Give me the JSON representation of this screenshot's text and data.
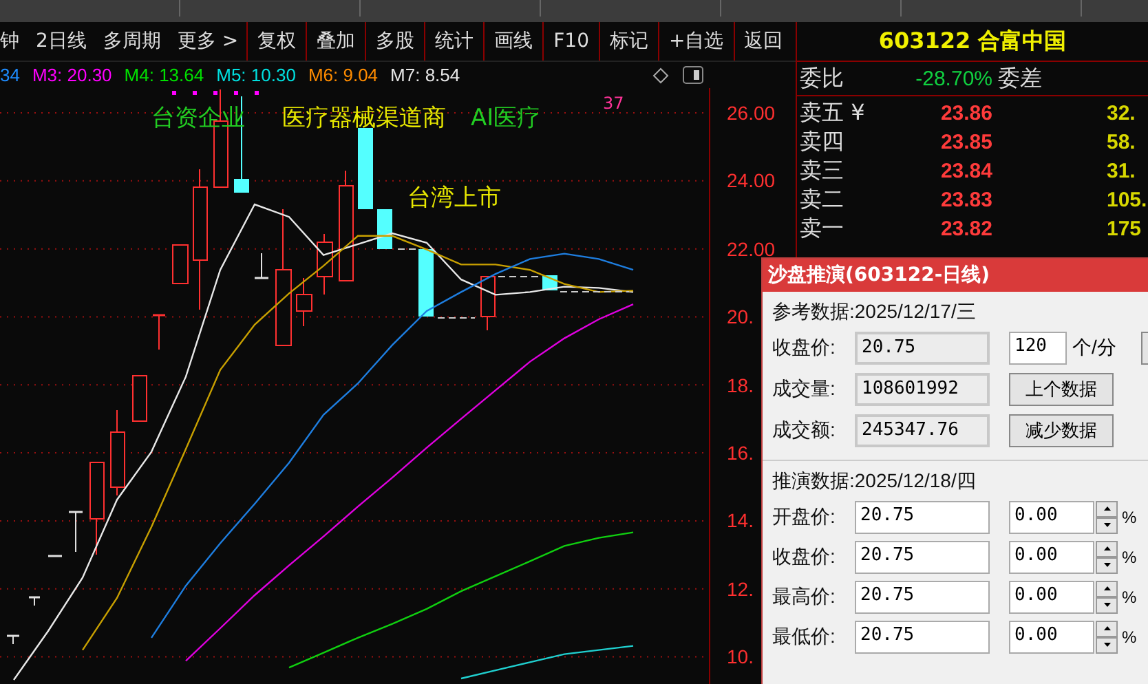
{
  "toolbar": {
    "items": [
      {
        "label": "钟",
        "boxed": false
      },
      {
        "label": "2日线",
        "boxed": false
      },
      {
        "label": "多周期",
        "boxed": false
      },
      {
        "label": "更多 >",
        "boxed": false
      },
      {
        "label": "复权",
        "boxed": true
      },
      {
        "label": "叠加",
        "boxed": true
      },
      {
        "label": "多股",
        "boxed": true
      },
      {
        "label": "统计",
        "boxed": true
      },
      {
        "label": "画线",
        "boxed": true
      },
      {
        "label": "F10",
        "boxed": true
      },
      {
        "label": "标记",
        "boxed": true
      },
      {
        "label": "+自选",
        "boxed": true
      },
      {
        "label": "返回",
        "boxed": true
      }
    ]
  },
  "indicators": [
    {
      "label": "34",
      "color": "#1e8cff"
    },
    {
      "label": "M3: 20.30",
      "color": "#ff00ff"
    },
    {
      "label": "M4: 13.64",
      "color": "#00e000"
    },
    {
      "label": "M5: 10.30",
      "color": "#00e0e0"
    },
    {
      "label": "M6: 9.04",
      "color": "#ff8c00"
    },
    {
      "label": "M7: 8.54",
      "color": "#e8e8e8"
    }
  ],
  "chart": {
    "annotations": [
      {
        "text": "台资企业",
        "color": "#22cc22"
      },
      {
        "text": "医疗器械渠道商",
        "color": "#e8e800"
      },
      {
        "text": "AI医疗",
        "color": "#22cc22"
      },
      {
        "text": "37",
        "color": "#ff3399"
      },
      {
        "text": "台湾上市",
        "color": "#e8e800"
      }
    ],
    "chart_data": {
      "type": "line",
      "grid": true,
      "ylim": [
        9.2,
        26.73
      ],
      "yticks": [
        {
          "value": 26,
          "label": "26.00"
        },
        {
          "value": 24,
          "label": "24.00"
        },
        {
          "value": 22,
          "label": "22.00"
        },
        {
          "value": 20,
          "label": "20."
        },
        {
          "value": 18,
          "label": "18."
        },
        {
          "value": 16,
          "label": "16."
        },
        {
          "value": 14,
          "label": "14."
        },
        {
          "value": 12,
          "label": "12."
        },
        {
          "value": 10,
          "label": "10."
        }
      ],
      "series": [
        {
          "color": "#e8e8e8",
          "values": [
            9.32,
            10.76,
            12.33,
            14.62,
            16.03,
            18.24,
            21.38,
            23.31,
            22.94,
            21.82,
            22.14,
            22.46,
            22.18,
            21.1,
            20.65,
            20.73,
            20.89,
            20.85,
            20.73
          ]
        },
        {
          "color": "#c8a000",
          "values": [
            null,
            null,
            10.2,
            11.73,
            13.82,
            16.11,
            18.44,
            19.77,
            20.69,
            21.5,
            22.38,
            22.38,
            21.98,
            21.54,
            21.54,
            21.38,
            20.97,
            20.73,
            20.77
          ]
        },
        {
          "color": "#1e7ee0",
          "values": [
            null,
            null,
            null,
            null,
            10.56,
            12.09,
            13.34,
            14.5,
            15.71,
            17.12,
            18.04,
            19.17,
            20.17,
            20.73,
            21.26,
            21.7,
            21.86,
            21.7,
            21.38
          ]
        },
        {
          "color": "#e000e0",
          "values": [
            null,
            null,
            null,
            null,
            null,
            9.88,
            10.84,
            11.81,
            12.69,
            13.54,
            14.42,
            15.27,
            16.15,
            17.0,
            17.84,
            18.68,
            19.37,
            19.93,
            20.37
          ]
        },
        {
          "color": "#10d010",
          "values": [
            null,
            null,
            null,
            null,
            null,
            null,
            null,
            null,
            9.68,
            10.12,
            10.56,
            10.97,
            11.41,
            11.93,
            12.37,
            12.81,
            13.26,
            13.5,
            13.66
          ]
        },
        {
          "color": "#20d0d0",
          "values": [
            null,
            null,
            null,
            null,
            null,
            null,
            null,
            null,
            null,
            null,
            null,
            null,
            null,
            9.36,
            9.6,
            9.84,
            10.08,
            10.2,
            10.32
          ]
        }
      ]
    }
  },
  "quote": {
    "code": "603122",
    "name": "合富中国",
    "ratio_label": "委比",
    "ratio": "-28.70%",
    "diff_label": "委差",
    "asks": [
      {
        "label": "卖五 ¥",
        "price": "23.86",
        "volume": "32."
      },
      {
        "label": "卖四",
        "price": "23.85",
        "volume": "58."
      },
      {
        "label": "卖三",
        "price": "23.84",
        "volume": "31."
      },
      {
        "label": "卖二",
        "price": "23.83",
        "volume": "105."
      },
      {
        "label": "卖一",
        "price": "23.82",
        "volume": "175"
      }
    ]
  },
  "dialog": {
    "title": "沙盘推演(603122-日线)",
    "reference_date": "参考数据:2025/12/17/三",
    "reference_fields": [
      {
        "label": "收盘价:",
        "value": "20.75"
      },
      {
        "label": "成交量:",
        "value": "108601992"
      },
      {
        "label": "成交额:",
        "value": "245347.76"
      }
    ],
    "rate_value": "120",
    "rate_unit": "个/分",
    "buttons": [
      "上个数据",
      "减少数据"
    ],
    "forecast_date": "推演数据:2025/12/18/四",
    "forecast_fields": [
      {
        "label": "开盘价:",
        "value": "20.75",
        "percent": "0.00",
        "unit": "%"
      },
      {
        "label": "收盘价:",
        "value": "20.75",
        "percent": "0.00",
        "unit": "%"
      },
      {
        "label": "最高价:",
        "value": "20.75",
        "percent": "0.00",
        "unit": "%"
      },
      {
        "label": "最低价:",
        "value": "20.75",
        "percent": "0.00",
        "unit": "%"
      }
    ]
  }
}
